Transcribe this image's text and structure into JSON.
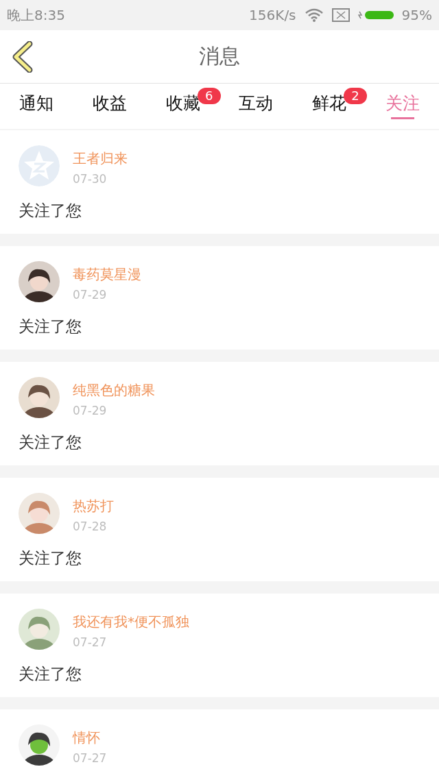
{
  "status_bar": {
    "time": "晚上8:35",
    "speed": "156K/s",
    "battery": "95%"
  },
  "header": {
    "title": "消息"
  },
  "tabs": [
    {
      "label": "通知",
      "selected": false
    },
    {
      "label": "收益",
      "selected": false
    },
    {
      "label": "收藏",
      "selected": false,
      "badge": "6"
    },
    {
      "label": "互动",
      "selected": false
    },
    {
      "label": "鲜花",
      "selected": false,
      "badge": "2"
    },
    {
      "label": "关注",
      "selected": true
    }
  ],
  "messages": [
    {
      "avatar": {
        "kind": "default"
      },
      "name": "王者归来",
      "date": "07-30",
      "text": "关注了您"
    },
    {
      "name": "毒药莫星漫",
      "date": "07-29",
      "text": "关注了您"
    },
    {
      "name": "纯黑色的糖果",
      "date": "07-29",
      "text": "关注了您"
    },
    {
      "name": "热苏打",
      "date": "07-28",
      "text": "关注了您"
    },
    {
      "name": "我还有我*便不孤独",
      "date": "07-27",
      "text": "关注了您"
    },
    {
      "name": "情怀",
      "date": "07-27"
    }
  ]
}
